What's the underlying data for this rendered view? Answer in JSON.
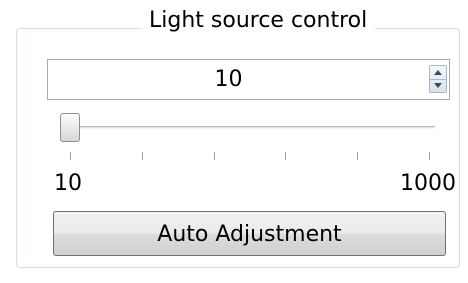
{
  "group": {
    "title": "Light source control"
  },
  "spinbox": {
    "value": "10",
    "up_icon": "spin-up-icon",
    "down_icon": "spin-down-icon"
  },
  "slider": {
    "value": 10,
    "min": 10,
    "max": 1000,
    "tick_count": 6,
    "min_label": "10",
    "max_label": "1000"
  },
  "button": {
    "label": "Auto Adjustment"
  }
}
